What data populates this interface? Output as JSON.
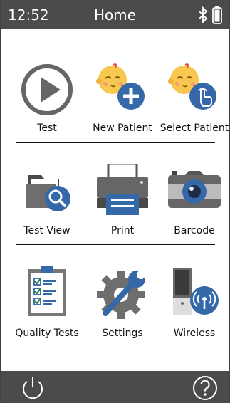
{
  "status_bar": {
    "time": "12:52",
    "title": "Home"
  },
  "tiles": [
    {
      "label": "Test",
      "icon": "play-icon"
    },
    {
      "label": "New Patient",
      "icon": "baby-plus-icon"
    },
    {
      "label": "Select Patient",
      "icon": "baby-hand-icon"
    },
    {
      "label": "Test View",
      "icon": "folder-search-icon"
    },
    {
      "label": "Print",
      "icon": "printer-icon"
    },
    {
      "label": "Barcode",
      "icon": "camera-icon"
    },
    {
      "label": "Quality Tests",
      "icon": "checklist-icon"
    },
    {
      "label": "Settings",
      "icon": "gear-wrench-icon"
    },
    {
      "label": "Wireless",
      "icon": "wireless-device-icon"
    }
  ],
  "colors": {
    "bar": "#4b4b4b",
    "accent": "#3468a8",
    "skin": "#f7c74f"
  }
}
